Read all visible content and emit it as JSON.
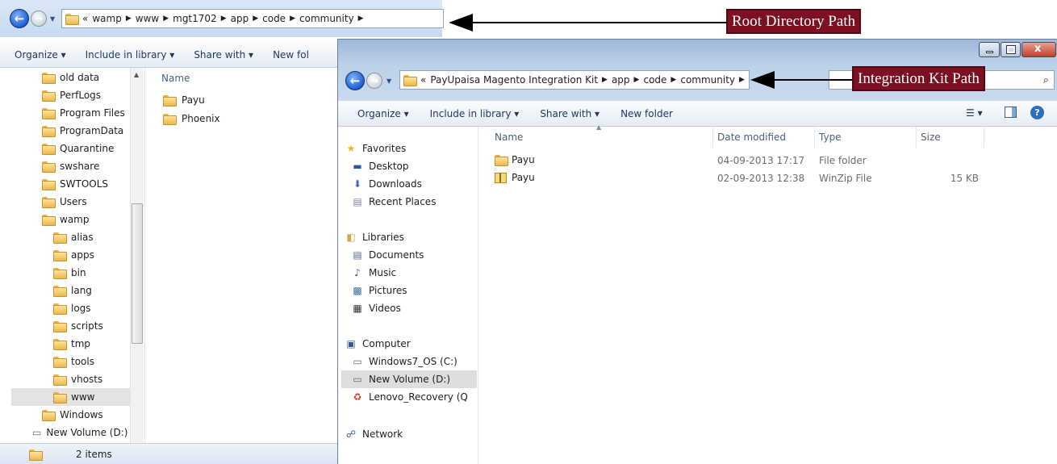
{
  "root_window": {
    "address_parts": [
      "«",
      "wamp",
      "www",
      "mgt1702",
      "app",
      "code",
      "community"
    ],
    "toolbar": {
      "organize": "Organize ▾",
      "include_in_library": "Include in library ▾",
      "share_with": "Share with ▾",
      "new_folder": "New fol"
    },
    "tree_items": [
      "old data",
      "PerfLogs",
      "Program Files",
      "ProgramData",
      "Quarantine",
      "swshare",
      "SWTOOLS",
      "Users",
      "wamp",
      "alias",
      "apps",
      "bin",
      "lang",
      "logs",
      "scripts",
      "tmp",
      "tools",
      "vhosts",
      "www",
      "Windows",
      "New Volume (D:)"
    ],
    "list_header": "Name",
    "files": [
      "Payu",
      "Phoenix"
    ],
    "status": "2 items"
  },
  "kit_window": {
    "address_parts": [
      "«",
      "PayUpaisa Magento Integration Kit",
      "app",
      "code",
      "community"
    ],
    "toolbar": {
      "organize": "Organize ▾",
      "include_in_library": "Include in library ▾",
      "share_with": "Share with ▾",
      "new_folder": "New folder"
    },
    "nav": {
      "favorites": "Favorites",
      "desktop": "Desktop",
      "downloads": "Downloads",
      "recent_places": "Recent Places",
      "libraries": "Libraries",
      "documents": "Documents",
      "music": "Music",
      "pictures": "Pictures",
      "videos": "Videos",
      "computer": "Computer",
      "drive_c": "Windows7_OS (C:)",
      "drive_d": "New Volume (D:)",
      "drive_q": "Lenovo_Recovery (Q",
      "network": "Network"
    },
    "columns": {
      "name": "Name",
      "date_modified": "Date modified",
      "type": "Type",
      "size": "Size"
    },
    "rows": [
      {
        "name": "Payu",
        "date": "04-09-2013 17:17",
        "type": "File folder",
        "size": ""
      },
      {
        "name": "Payu",
        "date": "02-09-2013 12:38",
        "type": "WinZip File",
        "size": "15 KB"
      }
    ]
  },
  "annotations": {
    "root_path_label": "Root Directory Path",
    "kit_path_label": "Integration Kit Path",
    "color": "#7a1020"
  }
}
